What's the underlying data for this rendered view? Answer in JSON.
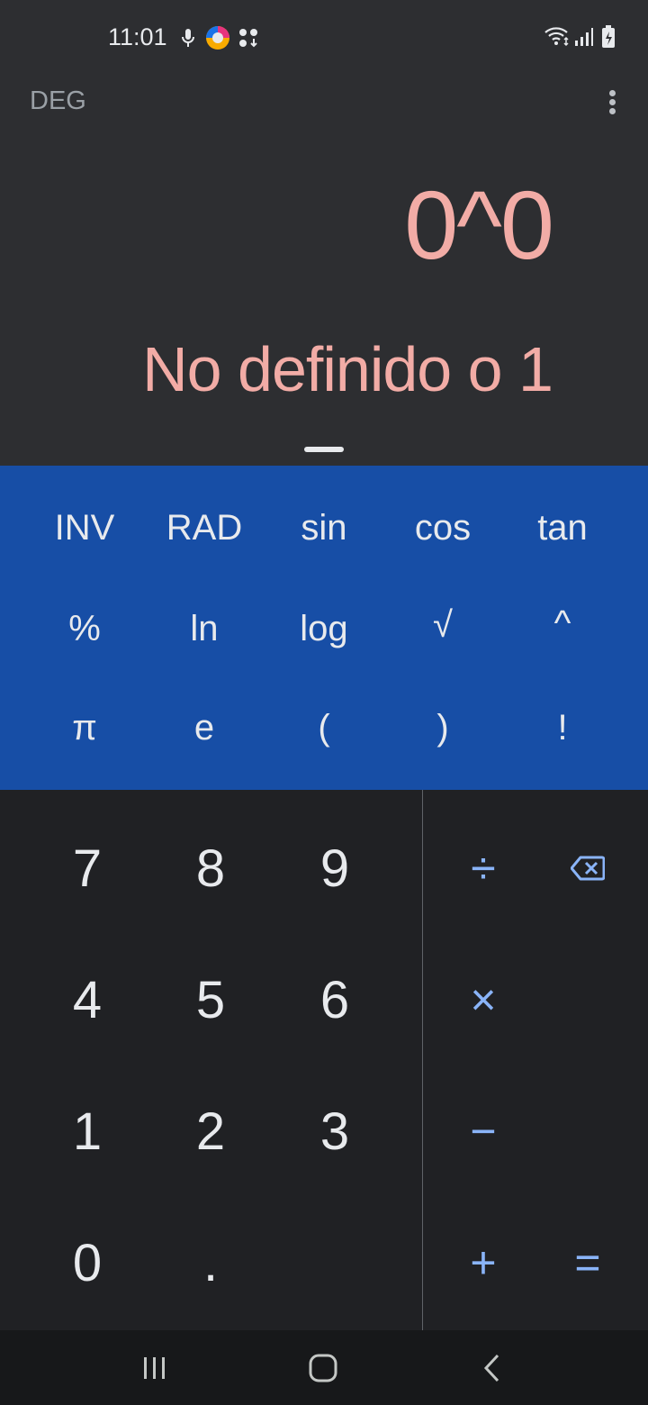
{
  "status_bar": {
    "time": "11:01",
    "icons": [
      "mic-icon",
      "color-app-icon",
      "apps-download-icon",
      "wifi-icon",
      "signal-icon",
      "battery-charging-icon"
    ]
  },
  "header": {
    "angle_mode": "DEG",
    "menu_icon": "more-vert-icon"
  },
  "display": {
    "expression": "0^0",
    "result": "No definido o 1"
  },
  "scientific": {
    "row1": [
      "INV",
      "RAD",
      "sin",
      "cos",
      "tan"
    ],
    "row2": [
      "%",
      "ln",
      "log",
      "√",
      "^"
    ],
    "row3": [
      "π",
      "e",
      "(",
      ")",
      "!"
    ]
  },
  "numpad": {
    "digits": [
      "7",
      "8",
      "9",
      "4",
      "5",
      "6",
      "1",
      "2",
      "3",
      "0",
      "."
    ],
    "divide": "÷",
    "backspace_icon": "backspace-icon",
    "multiply": "×",
    "minus": "−",
    "plus": "+",
    "equals": "="
  },
  "colors": {
    "display_text": "#f2aca6",
    "scientific_panel": "#174ea6",
    "operator": "#8ab4f8",
    "background": "#2d2e31",
    "pad_background": "#202124"
  },
  "nav_bar": {
    "icons": [
      "recent-apps-icon",
      "home-icon",
      "back-icon"
    ]
  }
}
